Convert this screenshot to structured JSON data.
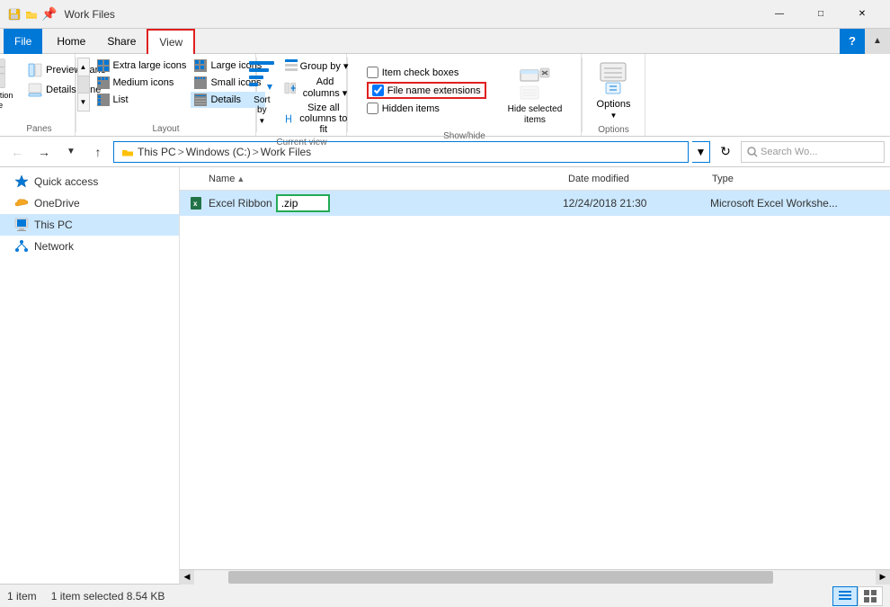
{
  "window": {
    "title": "Work Files",
    "controls": {
      "minimize": "—",
      "maximize": "□",
      "close": "✕"
    }
  },
  "ribbon_tabs": {
    "file": "File",
    "home": "Home",
    "share": "Share",
    "view": "View"
  },
  "ribbon": {
    "panes": {
      "label": "Panes",
      "navigation_pane": "Navigation\npane",
      "preview_pane": "Preview pane",
      "details_pane": "Details pane"
    },
    "layout": {
      "label": "Layout",
      "extra_large_icons": "Extra large icons",
      "large_icons": "Large icons",
      "medium_icons": "Medium icons",
      "small_icons": "Small icons",
      "list": "List",
      "details": "Details"
    },
    "current_view": {
      "label": "Current view",
      "sort_by": "Sort\nby"
    },
    "show_hide": {
      "label": "Show/hide",
      "item_check_boxes": "Item check boxes",
      "file_name_extensions": "File name extensions",
      "hidden_items": "Hidden items",
      "hide_selected": "Hide selected\nitems"
    },
    "options": {
      "label": "Options",
      "options": "Options"
    }
  },
  "address_bar": {
    "path": "This PC > Windows (C:) > Work Files",
    "search_placeholder": "Search Wo...",
    "path_parts": [
      "This PC",
      "Windows (C:)",
      "Work Files"
    ]
  },
  "sidebar": {
    "items": [
      {
        "label": "Quick access",
        "icon": "star",
        "active": false
      },
      {
        "label": "OneDrive",
        "icon": "cloud",
        "active": false
      },
      {
        "label": "This PC",
        "icon": "computer",
        "active": true
      },
      {
        "label": "Network",
        "icon": "network",
        "active": false
      }
    ]
  },
  "file_list": {
    "columns": [
      {
        "label": "Name",
        "sort": "asc"
      },
      {
        "label": "Date modified"
      },
      {
        "label": "Type"
      }
    ],
    "files": [
      {
        "name": "Excel Ribbon",
        "ext": ".zip",
        "full_name": "Excel Ribbon.zip",
        "editing": true,
        "date": "12/24/2018 21:30",
        "type": "Microsoft Excel Workshe...",
        "selected": true
      }
    ]
  },
  "status_bar": {
    "item_count": "1 item",
    "selected_info": "1 item selected  8.54 KB",
    "item_label": "Item"
  }
}
